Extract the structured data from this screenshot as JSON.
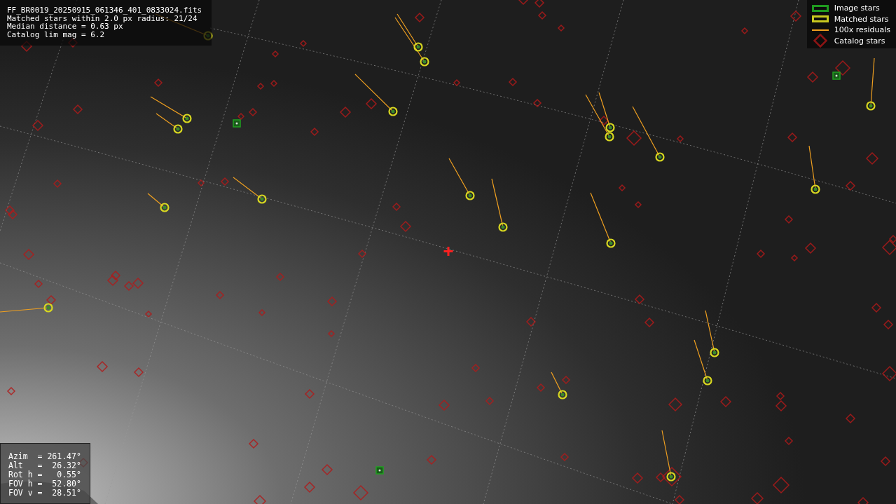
{
  "info_box": {
    "lines": [
      "FF_BR0019_20250915_061346_401_0833024.fits",
      "Matched stars within 2.0 px radius: 21/24",
      "Median distance = 0.63 px",
      "Catalog lim mag = 6.2"
    ]
  },
  "legend": [
    {
      "kind": "square",
      "label": "Image stars",
      "color": "#1f9a1f"
    },
    {
      "kind": "square",
      "label": "Matched stars",
      "color": "#c8c820"
    },
    {
      "kind": "line",
      "label": "100x residuals",
      "color": "#f0a020"
    },
    {
      "kind": "diamond",
      "label": "Catalog stars",
      "color": "#8b1414"
    }
  ],
  "pointing_box": {
    "lines": [
      "Azim  = 261.47°",
      "Alt   =  26.32°",
      "Rot h =   0.55°",
      "FOV h =  52.80°",
      "FOV v =  28.51°"
    ]
  }
}
